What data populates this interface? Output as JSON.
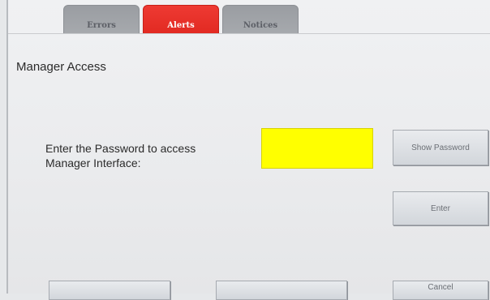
{
  "tabs": [
    {
      "label": "Errors",
      "active": false
    },
    {
      "label": "Alerts",
      "active": true,
      "color": "#e8302a"
    },
    {
      "label": "Notices",
      "active": false
    }
  ],
  "page_title": "Manager Access",
  "prompt": {
    "line1": "Enter the Password to access",
    "line2": "Manager Interface:"
  },
  "password_field": {
    "value": "",
    "background": "#ffff00"
  },
  "buttons": {
    "show_password": "Show Password",
    "enter": "Enter",
    "bottom_left": "",
    "bottom_middle": "",
    "cancel": "Cancel"
  }
}
